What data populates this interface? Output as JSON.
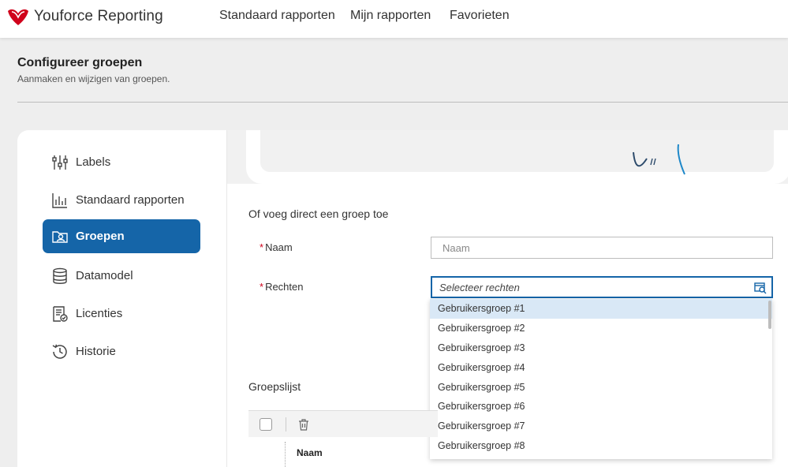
{
  "app": {
    "title": "Youforce Reporting"
  },
  "nav": {
    "items": [
      "Standaard rapporten",
      "Mijn rapporten",
      "Favorieten"
    ]
  },
  "page": {
    "title": "Configureer groepen",
    "subtitle": "Aanmaken en wijzigen van groepen."
  },
  "sidebar": {
    "items": [
      {
        "label": "Labels",
        "icon": "sliders-icon",
        "active": false
      },
      {
        "label": "Standaard rapporten",
        "icon": "bar-chart-icon",
        "active": false
      },
      {
        "label": "Groepen",
        "icon": "group-folder-icon",
        "active": true
      },
      {
        "label": "Datamodel",
        "icon": "database-icon",
        "active": false
      },
      {
        "label": "Licenties",
        "icon": "license-icon",
        "active": false
      },
      {
        "label": "Historie",
        "icon": "history-icon",
        "active": false
      }
    ]
  },
  "form": {
    "section_label": "Of voeg direct een groep toe",
    "required_marker": "*",
    "name_label": "Naam",
    "name_placeholder": "Naam",
    "rights_label": "Rechten",
    "rights_placeholder": "Selecteer rechten"
  },
  "dropdown": {
    "options": [
      "Gebruikersgroep #1",
      "Gebruikersgroep #2",
      "Gebruikersgroep #3",
      "Gebruikersgroep #4",
      "Gebruikersgroep #5",
      "Gebruikersgroep #6",
      "Gebruikersgroep #7",
      "Gebruikersgroep #8"
    ],
    "highlighted": "Gebruikersgroep #1"
  },
  "groups": {
    "title": "Groepslijst",
    "column_name": "Naam"
  },
  "colors": {
    "accent": "#1565a8",
    "brand": "#d0021b",
    "highlight": "#d9e8f6"
  }
}
